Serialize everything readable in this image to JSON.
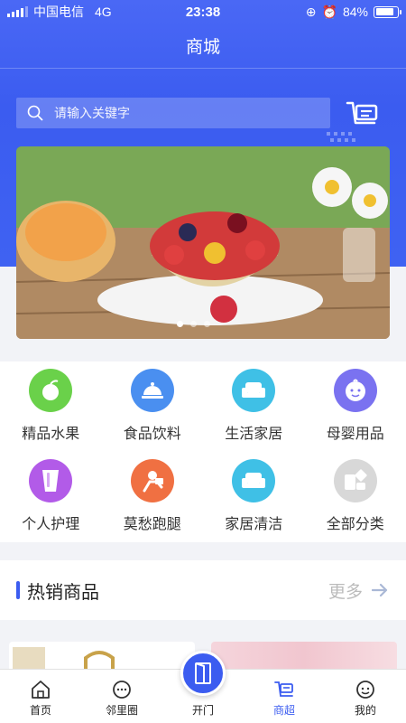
{
  "status_bar": {
    "carrier": "中国电信",
    "network": "4G",
    "time": "23:38",
    "battery": "84%",
    "battery_level": 0.84
  },
  "navbar": {
    "title": "商城"
  },
  "search": {
    "placeholder": "请输入关键字"
  },
  "banner": {
    "pages": 3,
    "active_page": 1
  },
  "categories": [
    {
      "label": "精品水果",
      "icon": "fruit-icon",
      "color": "#6ad14a"
    },
    {
      "label": "食品饮料",
      "icon": "food-cover-icon",
      "color": "#4a8ff0"
    },
    {
      "label": "生活家居",
      "icon": "sofa-icon",
      "color": "#3fc0e6"
    },
    {
      "label": "母婴用品",
      "icon": "baby-icon",
      "color": "#7a72f0"
    },
    {
      "label": "个人护理",
      "icon": "lotion-icon",
      "color": "#b25be8"
    },
    {
      "label": "莫愁跑腿",
      "icon": "runner-icon",
      "color": "#f07042"
    },
    {
      "label": "家居清洁",
      "icon": "sofa-icon",
      "color": "#3fc0e6"
    },
    {
      "label": "全部分类",
      "icon": "category-icon",
      "color": "#d8d8d8"
    }
  ],
  "hot_section": {
    "title": "热销商品",
    "more": "更多"
  },
  "tabbar": {
    "items": [
      {
        "label": "首页",
        "icon": "home-icon"
      },
      {
        "label": "邻里圈",
        "icon": "chat-icon"
      },
      {
        "label": "开门",
        "icon": "door-icon"
      },
      {
        "label": "商超",
        "icon": "cart-icon",
        "active": true
      },
      {
        "label": "我的",
        "icon": "user-icon"
      }
    ]
  },
  "colors": {
    "brand": "#3b5cf0",
    "text": "#333333"
  }
}
